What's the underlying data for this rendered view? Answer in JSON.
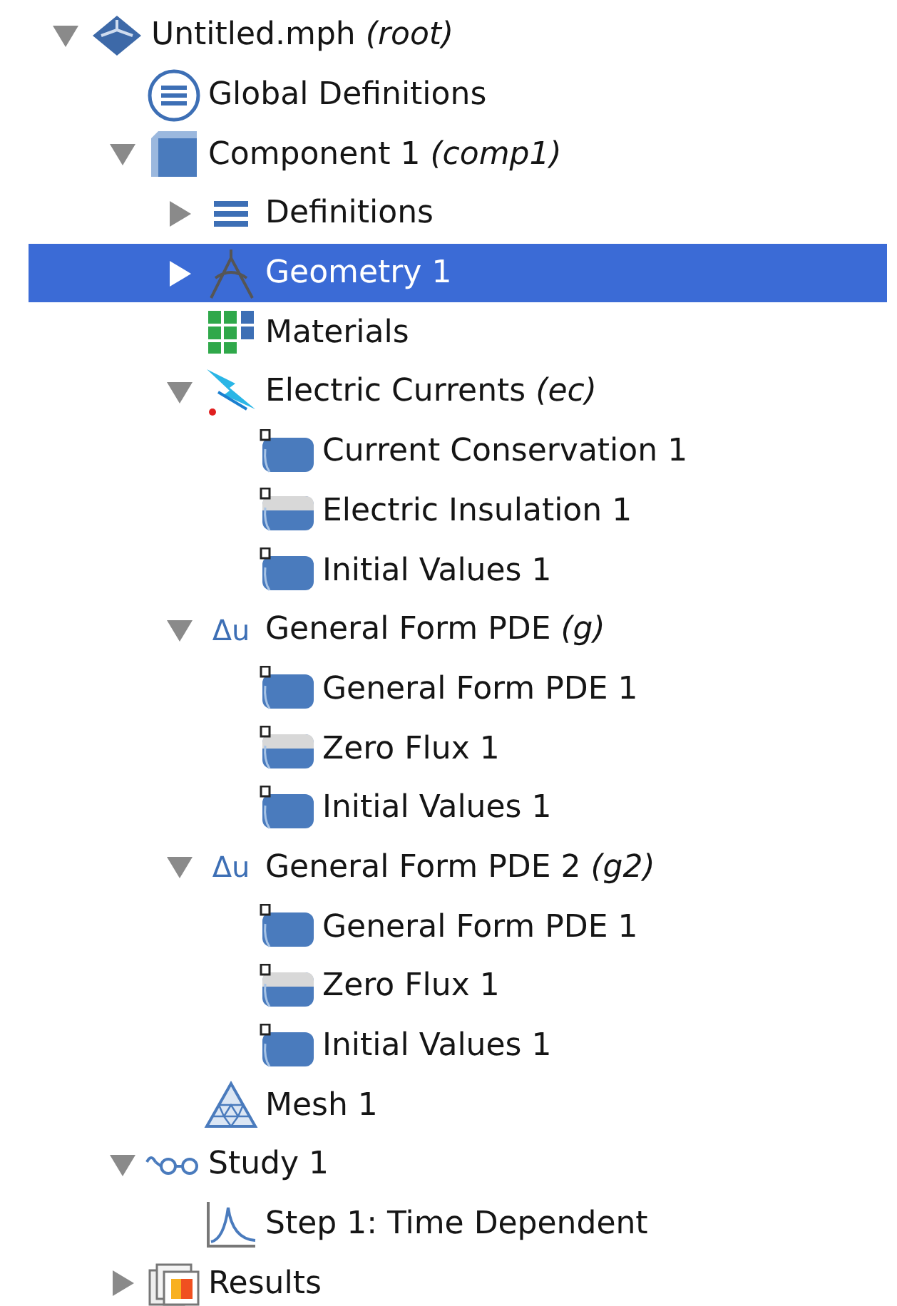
{
  "tree": [
    {
      "label": "Untitled.mph *(root)*",
      "kind": "model",
      "expanded": true,
      "selected": false,
      "children": [
        {
          "label": "Global Definitions",
          "kind": "global",
          "selected": false
        },
        {
          "label": "Component 1 *(comp1)*",
          "kind": "component",
          "expanded": true,
          "selected": false,
          "children": [
            {
              "label": "Definitions",
              "kind": "definitions",
              "expanded": false,
              "selected": false
            },
            {
              "label": "Geometry 1",
              "kind": "geometry",
              "expanded": false,
              "selected": true
            },
            {
              "label": "Materials",
              "kind": "materials",
              "selected": false
            },
            {
              "label": "Electric Currents *(ec)*",
              "kind": "physics",
              "expanded": true,
              "selected": false,
              "children": [
                {
                  "label": "Current Conservation 1",
                  "kind": "domain",
                  "selected": false
                },
                {
                  "label": "Electric Insulation 1",
                  "kind": "boundary",
                  "selected": false
                },
                {
                  "label": "Initial Values 1",
                  "kind": "domain",
                  "selected": false
                }
              ]
            },
            {
              "label": "General Form PDE *(g)*",
              "kind": "pde",
              "symbol": "Δu",
              "expanded": true,
              "selected": false,
              "children": [
                {
                  "label": "General Form PDE 1",
                  "kind": "domain",
                  "selected": false
                },
                {
                  "label": "Zero Flux 1",
                  "kind": "boundary",
                  "selected": false
                },
                {
                  "label": "Initial Values 1",
                  "kind": "domain",
                  "selected": false
                }
              ]
            },
            {
              "label": "General Form PDE 2 *(g2)*",
              "kind": "pde",
              "symbol": "Δu",
              "expanded": true,
              "selected": false,
              "children": [
                {
                  "label": "General Form PDE 1",
                  "kind": "domain",
                  "selected": false
                },
                {
                  "label": "Zero Flux 1",
                  "kind": "boundary",
                  "selected": false
                },
                {
                  "label": "Initial Values 1",
                  "kind": "domain",
                  "selected": false
                }
              ]
            },
            {
              "label": "Mesh 1",
              "kind": "mesh",
              "selected": false
            }
          ]
        },
        {
          "label": "Study 1",
          "kind": "study",
          "expanded": true,
          "selected": false,
          "children": [
            {
              "label": "Step 1: Time Dependent",
              "kind": "step",
              "selected": false
            }
          ]
        },
        {
          "label": "Results",
          "kind": "results",
          "expanded": false,
          "selected": false
        }
      ]
    }
  ]
}
